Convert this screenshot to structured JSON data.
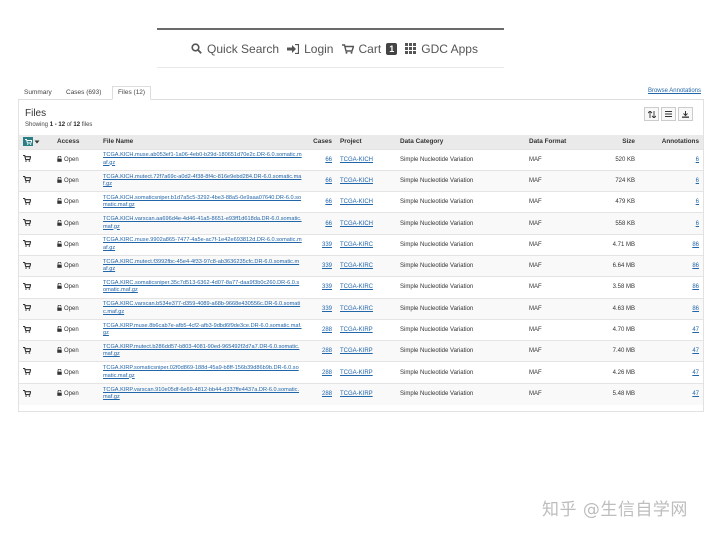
{
  "nav": {
    "quick_search": "Quick Search",
    "login": "Login",
    "cart": "Cart",
    "cart_count": "1",
    "gdc_apps": "GDC Apps"
  },
  "tabs": [
    "Summary",
    "Cases (693)",
    "Files (12)"
  ],
  "browse_annotations": "Browse Annotations",
  "files": {
    "title": "Files",
    "showing_prefix": "Showing ",
    "showing_range": "1 - 12",
    "showing_of": " of ",
    "showing_total": "12",
    "showing_suffix": " files"
  },
  "columns": [
    "Access",
    "File Name",
    "Cases",
    "Project",
    "Data Category",
    "Data Format",
    "Size",
    "Annotations"
  ],
  "rows": [
    {
      "access": "Open",
      "file": "TCGA.KICH.muse.ab053ef1-1a06-4eb0-b29d-180651d70e2c.DR-6.0.somatic.maf.gz",
      "cases": "66",
      "project": "TCGA-KICH",
      "category": "Simple Nucleotide Variation",
      "format": "MAF",
      "size": "520 KB",
      "annotations": "6"
    },
    {
      "access": "Open",
      "file": "TCGA.KICH.mutect.72f7a69c-a0d2-4f38-8f4c-816e9ebd284.DR-6.0.somatic.maf.gz",
      "cases": "66",
      "project": "TCGA-KICH",
      "category": "Simple Nucleotide Variation",
      "format": "MAF",
      "size": "724 KB",
      "annotations": "6"
    },
    {
      "access": "Open",
      "file": "TCGA.KICH.somaticsniper.b1d7a5c5-3292-4be3-88a5-0e9aaa07640.DR-6.0.somatic.maf.gz",
      "cases": "66",
      "project": "TCGA-KICH",
      "category": "Simple Nucleotide Variation",
      "format": "MAF",
      "size": "479 KB",
      "annotations": "6"
    },
    {
      "access": "Open",
      "file": "TCGA.KICH.varscan.aa696d4e-4d46-41a5-8651-e93ff1d618da.DR-6.0.somatic.maf.gz",
      "cases": "66",
      "project": "TCGA-KICH",
      "category": "Simple Nucleotide Variation",
      "format": "MAF",
      "size": "558 KB",
      "annotations": "6"
    },
    {
      "access": "Open",
      "file": "TCGA.KIRC.muse.9902a865-7477-4a5e-ac7f-1e42e693812d.DR-6.0.somatic.maf.gz",
      "cases": "339",
      "project": "TCGA-KIRC",
      "category": "Simple Nucleotide Variation",
      "format": "MAF",
      "size": "4.71 MB",
      "annotations": "86"
    },
    {
      "access": "Open",
      "file": "TCGA.KIRC.mutect.f3992fbc-45e4-4f33-97c8-ab3636235cfc.DR-6.0.somatic.maf.gz",
      "cases": "339",
      "project": "TCGA-KIRC",
      "category": "Simple Nucleotide Variation",
      "format": "MAF",
      "size": "6.64 MB",
      "annotations": "86"
    },
    {
      "access": "Open",
      "file": "TCGA.KIRC.somaticsniper.35c7d513-6362-4d07-8a77-daa9f3b0c260.DR-6.0.somatic.maf.gz",
      "cases": "339",
      "project": "TCGA-KIRC",
      "category": "Simple Nucleotide Variation",
      "format": "MAF",
      "size": "3.58 MB",
      "annotations": "86"
    },
    {
      "access": "Open",
      "file": "TCGA.KIRC.varscan.b534e377-d359-4089-a68b-9668e430556c.DR-6.0.somatic.maf.gz",
      "cases": "339",
      "project": "TCGA-KIRC",
      "category": "Simple Nucleotide Variation",
      "format": "MAF",
      "size": "4.63 MB",
      "annotations": "86"
    },
    {
      "access": "Open",
      "file": "TCGA.KIRP.muse.8b6cab7e-afb5-4cf2-afb3-9dbd6f9de3ce.DR-6.0.somatic.maf.gz",
      "cases": "288",
      "project": "TCGA-KIRP",
      "category": "Simple Nucleotide Variation",
      "format": "MAF",
      "size": "4.70 MB",
      "annotations": "47"
    },
    {
      "access": "Open",
      "file": "TCGA.KIRP.mutect.b286dd57-b803-4081-90ed-965492f2d7a7.DR-6.0.somatic.maf.gz",
      "cases": "288",
      "project": "TCGA-KIRP",
      "category": "Simple Nucleotide Variation",
      "format": "MAF",
      "size": "7.40 MB",
      "annotations": "47"
    },
    {
      "access": "Open",
      "file": "TCGA.KIRP.somaticsniper.02f0d869-188d-45a9-b8ff-156b39d86b9b.DR-6.0.somatic.maf.gz",
      "cases": "288",
      "project": "TCGA-KIRP",
      "category": "Simple Nucleotide Variation",
      "format": "MAF",
      "size": "4.26 MB",
      "annotations": "47"
    },
    {
      "access": "Open",
      "file": "TCGA.KIRP.varscan.910e05df-6e69-4812-bb44-d337ffe4437a.DR-6.0.somatic.maf.gz",
      "cases": "288",
      "project": "TCGA-KIRP",
      "category": "Simple Nucleotide Variation",
      "format": "MAF",
      "size": "5.48 MB",
      "annotations": "47"
    }
  ],
  "watermark": "知乎 @生信自学网",
  "colors": {
    "link": "#2266aa",
    "cart_button": "#2a7f84",
    "header_bg": "#eaeaea"
  },
  "icons": {
    "search": "search-icon",
    "login": "sign-in-icon",
    "cart": "cart-icon",
    "apps": "grid-icon",
    "lock": "lock-icon",
    "sort": "sort-icon",
    "list": "list-icon",
    "download": "download-icon"
  }
}
